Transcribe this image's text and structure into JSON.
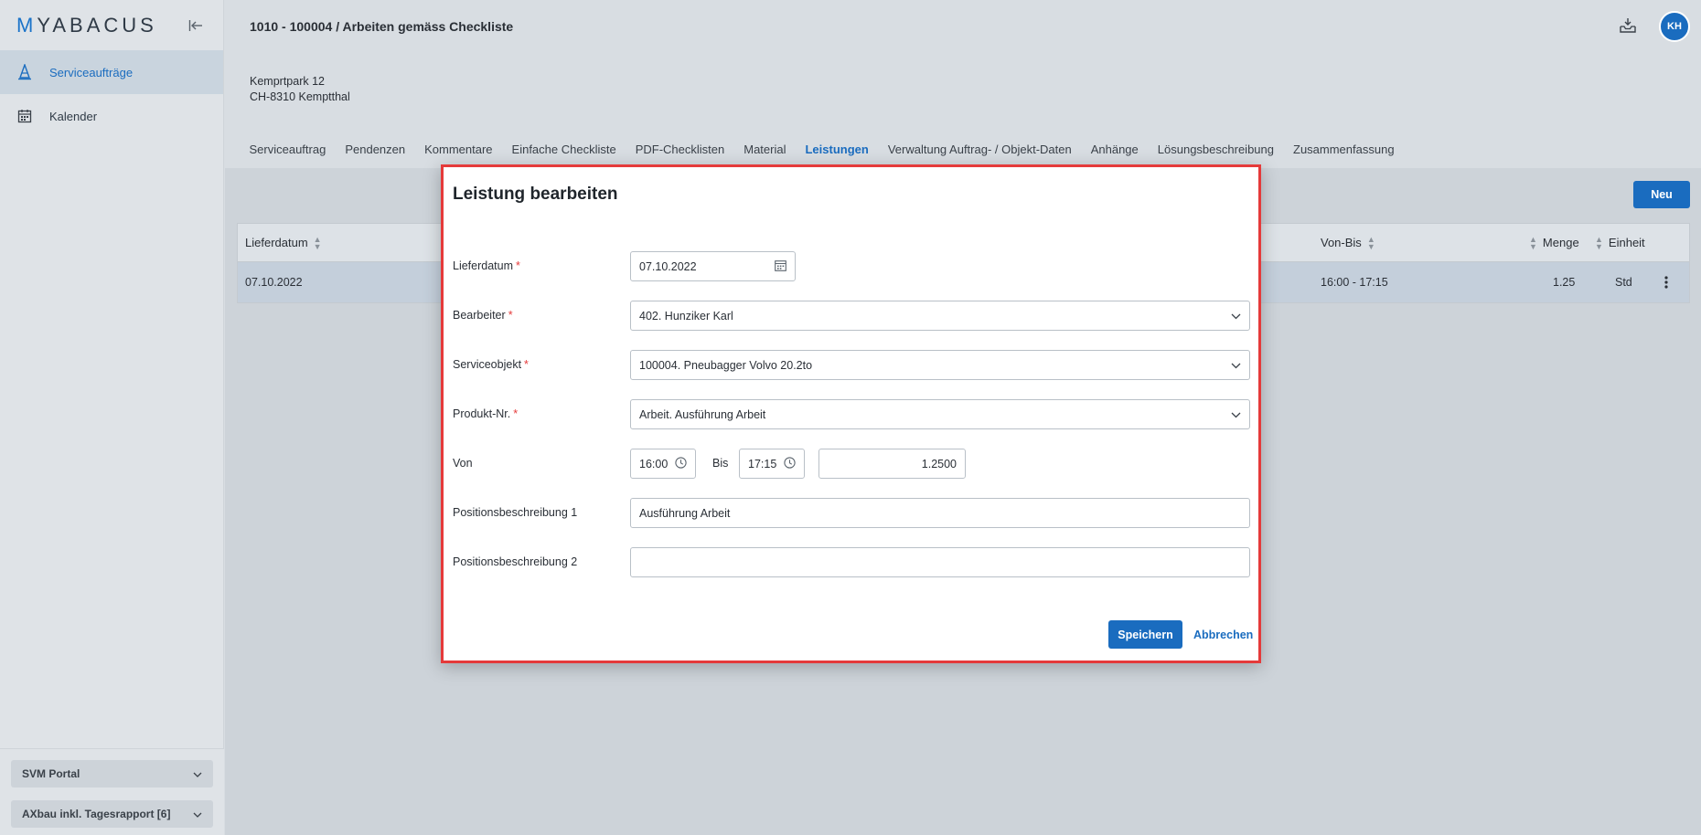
{
  "sidebar": {
    "logo_prefix": "M",
    "logo_rest": "YABACUS",
    "items": [
      {
        "label": "Serviceaufträge",
        "icon": "cone-icon",
        "active": true
      },
      {
        "label": "Kalender",
        "icon": "calendar-icon",
        "active": false
      }
    ],
    "bottom": [
      {
        "label": "SVM Portal"
      },
      {
        "label": "AXbau inkl. Tagesrapport [6]"
      }
    ]
  },
  "header": {
    "title": "1010 - 100004 / Arbeiten gemäss Checkliste",
    "avatar": "KH"
  },
  "address": {
    "line1": "Kemprtpark 12",
    "line2": "CH-8310 Kemptthal"
  },
  "tabs": [
    {
      "label": "Serviceauftrag"
    },
    {
      "label": "Pendenzen"
    },
    {
      "label": "Kommentare"
    },
    {
      "label": "Einfache Checkliste"
    },
    {
      "label": "PDF-Checklisten"
    },
    {
      "label": "Material"
    },
    {
      "label": "Leistungen",
      "active": true
    },
    {
      "label": "Verwaltung Auftrag- / Objekt-Daten"
    },
    {
      "label": "Anhänge"
    },
    {
      "label": "Lösungsbeschreibung"
    },
    {
      "label": "Zusammenfassung"
    }
  ],
  "toolbar": {
    "new_label": "Neu"
  },
  "table": {
    "headers": {
      "lieferdatum": "Lieferdatum",
      "vonbis": "Von-Bis",
      "menge": "Menge",
      "einheit": "Einheit"
    },
    "rows": [
      {
        "lieferdatum": "07.10.2022",
        "vonbis": "16:00 - 17:15",
        "menge": "1.25",
        "einheit": "Std"
      }
    ]
  },
  "modal": {
    "title": "Leistung bearbeiten",
    "fields": {
      "lieferdatum": {
        "label": "Lieferdatum",
        "value": "07.10.2022"
      },
      "bearbeiter": {
        "label": "Bearbeiter",
        "value": "402. Hunziker Karl"
      },
      "serviceobjekt": {
        "label": "Serviceobjekt",
        "value": "100004. Pneubagger Volvo 20.2to"
      },
      "produkt": {
        "label": "Produkt-Nr.",
        "value": "Arbeit. Ausführung Arbeit"
      },
      "von": {
        "label": "Von",
        "value": "16:00"
      },
      "bis": {
        "label": "Bis",
        "value": "17:15"
      },
      "menge": {
        "value": "1.2500"
      },
      "pos1": {
        "label": "Positionsbeschreibung 1",
        "value": "Ausführung Arbeit"
      },
      "pos2": {
        "label": "Positionsbeschreibung 2",
        "value": ""
      }
    },
    "required_mark": "*",
    "save_label": "Speichern",
    "cancel_label": "Abbrechen"
  }
}
